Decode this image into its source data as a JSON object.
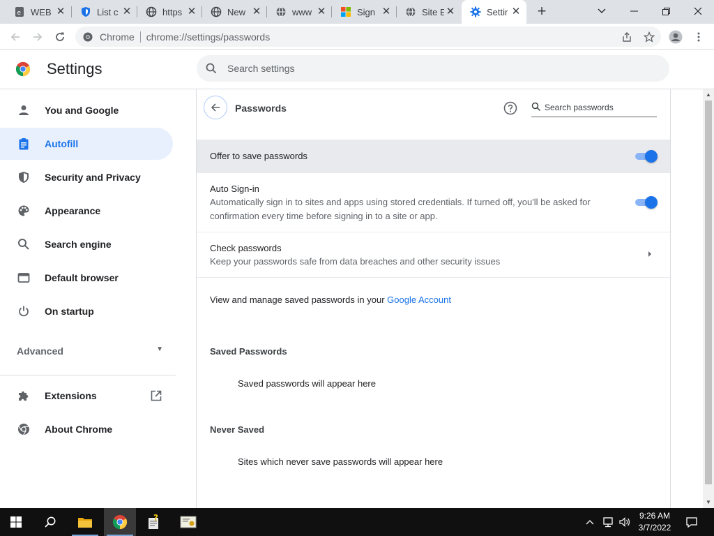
{
  "browser": {
    "tabs": [
      {
        "title": "WEB",
        "icon": "page-favicon"
      },
      {
        "title": "List c",
        "icon": "shield-favicon"
      },
      {
        "title": "https",
        "icon": "globe-favicon"
      },
      {
        "title": "New",
        "icon": "globe-favicon"
      },
      {
        "title": "www",
        "icon": "globe-favicon"
      },
      {
        "title": "Sign",
        "icon": "microsoft-favicon"
      },
      {
        "title": "Site E",
        "icon": "globe-favicon"
      },
      {
        "title": "Settir",
        "icon": "gear-favicon"
      }
    ],
    "chip": "Chrome",
    "url": "chrome://settings/passwords"
  },
  "settings": {
    "title": "Settings",
    "search_placeholder": "Search settings"
  },
  "sidebar": {
    "items": [
      {
        "label": "You and Google",
        "icon": "person-icon"
      },
      {
        "label": "Autofill",
        "icon": "clipboard-icon"
      },
      {
        "label": "Security and Privacy",
        "icon": "shield-icon"
      },
      {
        "label": "Appearance",
        "icon": "palette-icon"
      },
      {
        "label": "Search engine",
        "icon": "search-icon"
      },
      {
        "label": "Default browser",
        "icon": "browser-icon"
      },
      {
        "label": "On startup",
        "icon": "power-icon"
      }
    ],
    "advanced": "Advanced",
    "extensions": "Extensions",
    "about": "About Chrome"
  },
  "passwords": {
    "title": "Passwords",
    "search_placeholder": "Search passwords",
    "offer_label": "Offer to save passwords",
    "offer_on": true,
    "autosignin_label": "Auto Sign-in",
    "autosignin_desc": "Automatically sign in to sites and apps using stored credentials. If turned off, you'll be asked for confirmation every time before signing in to a site or app.",
    "autosignin_on": true,
    "check_label": "Check passwords",
    "check_desc": "Keep your passwords safe from data breaches and other security issues",
    "manage_text": "View and manage saved passwords in your ",
    "manage_link": "Google Account",
    "saved_head": "Saved Passwords",
    "saved_empty": "Saved passwords will appear here",
    "never_head": "Never Saved",
    "never_empty": "Sites which never save passwords will appear here"
  },
  "taskbar": {
    "time": "9:26 AM",
    "date": "3/7/2022"
  },
  "colors": {
    "accent": "#1a73e8",
    "selected_bg": "#e8f0fe"
  }
}
